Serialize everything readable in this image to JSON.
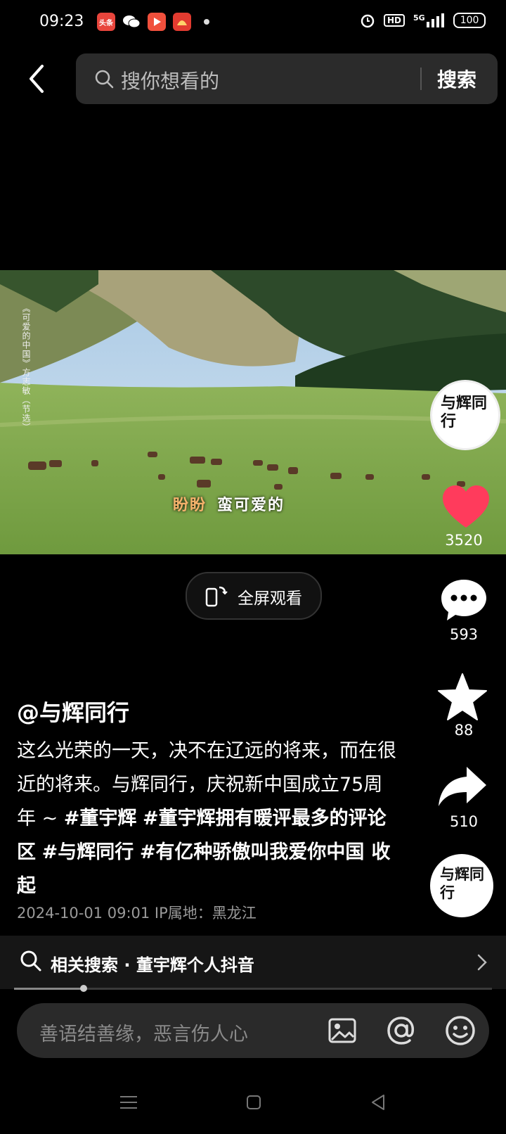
{
  "status_bar": {
    "time": "09:23",
    "app_icons": [
      {
        "name": "toutiao-app-icon",
        "label": "头条",
        "color": "#e8453c"
      },
      {
        "name": "wechat-app-icon",
        "label": "",
        "color": "#000000"
      },
      {
        "name": "video-app-icon",
        "label": "",
        "color": "#f0503c"
      },
      {
        "name": "red-app-icon",
        "label": "",
        "color": "#e23b30"
      }
    ],
    "hd": "HD",
    "network": "5G",
    "battery": "100"
  },
  "search": {
    "placeholder": "搜你想看的",
    "button": "搜索"
  },
  "video": {
    "subtitle_highlight": "盼盼",
    "subtitle_rest": "蛮可爱的",
    "vertical_caption": "《可爱的中国》方志敏（节选）"
  },
  "rail": {
    "avatar_text": "与辉同行",
    "likes": "3520",
    "comments": "593",
    "favorites": "88",
    "shares": "510",
    "like_color": "#ff3b5c"
  },
  "fullscreen": {
    "label": "全屏观看"
  },
  "post": {
    "author": "@与辉同行",
    "text": "这么光荣的一天，决不在辽远的将来，而在很近的将来。与辉同行，庆祝新中国成立75周年 ~ ",
    "tags": [
      "#董宇辉",
      "#董宇辉拥有暖评最多的评论区",
      "#与辉同行",
      "#有亿种骄傲叫我爱你中国"
    ],
    "fold": "收起",
    "meta": "2024-10-01 09:01  IP属地：黑龙江"
  },
  "related": {
    "text": "相关搜索 · 董宇辉个人抖音"
  },
  "progress": 0.145,
  "comment_input": {
    "placeholder": "善语结善缘，恶言伤人心"
  }
}
